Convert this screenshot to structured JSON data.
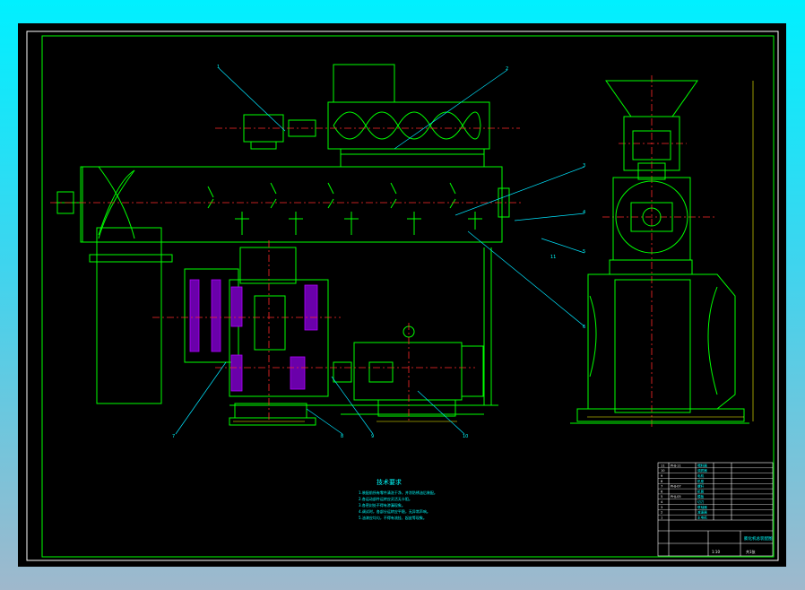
{
  "drawing": {
    "title_zh": "技术要求",
    "requirements": [
      "1.装配前所有零件清洗干净，并涂防锈油后装配。",
      "2.各运动部件运转应灵活无卡阻。",
      "3.各密封处不得有渗漏现象。",
      "4.调试时，各部分运转应平稳，无异常声响。",
      "5.油漆应均匀，不得有流挂、起皮等现象。"
    ],
    "balloons": [
      "1",
      "2",
      "3",
      "4",
      "5",
      "6",
      "7",
      "8",
      "9",
      "10",
      "11"
    ],
    "title_block": {
      "drawing_name": "膨化机总装配图",
      "scale": "1:10",
      "sheet": "共1张"
    },
    "parts_list": [
      {
        "no": "11",
        "code": "PHJ-11",
        "name": "喂料器"
      },
      {
        "no": "10",
        "code": "",
        "name": "调质器"
      },
      {
        "no": "9",
        "code": "",
        "name": "电机"
      },
      {
        "no": "8",
        "code": "",
        "name": "机座"
      },
      {
        "no": "7",
        "code": "PHJ-07",
        "name": "螺杆"
      },
      {
        "no": "6",
        "code": "",
        "name": "机筒"
      },
      {
        "no": "5",
        "code": "PHJ-05",
        "name": "模板"
      },
      {
        "no": "4",
        "code": "",
        "name": "切刀"
      },
      {
        "no": "3",
        "code": "",
        "name": "联轴器"
      },
      {
        "no": "2",
        "code": "",
        "name": "减速器"
      },
      {
        "no": "1",
        "code": "",
        "name": "主电机"
      }
    ]
  },
  "colors": {
    "background": "#000000",
    "frame": "#ffffff",
    "geometry": "#00ff00",
    "leader": "#00e5ff",
    "center_line": "#ff2a2a",
    "hatch": "#b000ff",
    "dimension": "#ffff00",
    "text": "#00ffff"
  }
}
